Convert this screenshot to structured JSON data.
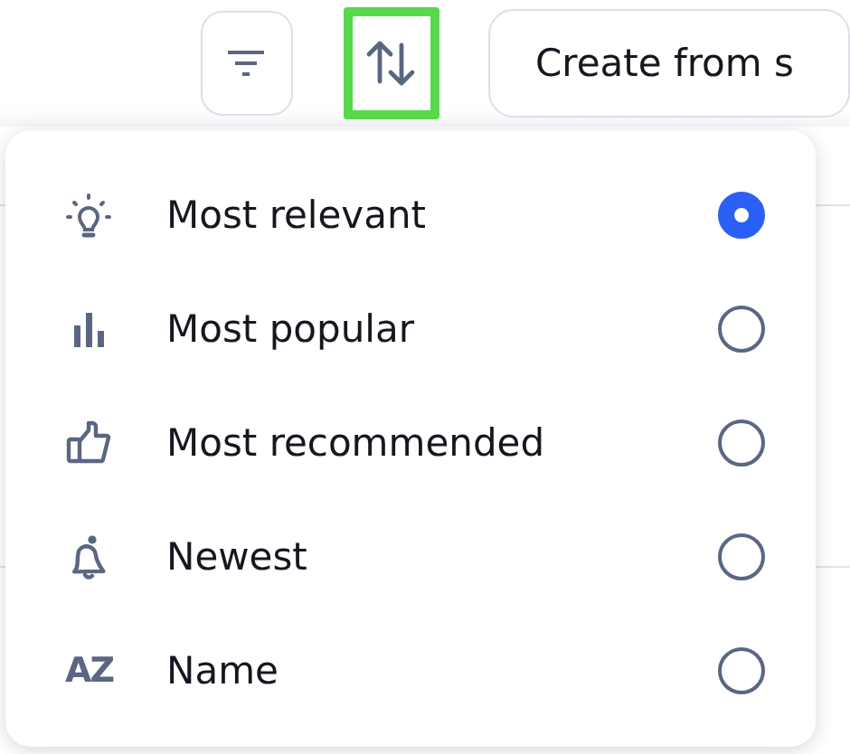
{
  "toolbar": {
    "filter_button": {
      "selected": false
    },
    "sort_button": {
      "selected": true
    },
    "create_button": {
      "label": "Create from s"
    }
  },
  "sort_menu": {
    "options": [
      {
        "kind": "bulb",
        "label": "Most relevant",
        "selected": true
      },
      {
        "kind": "bars",
        "label": "Most popular",
        "selected": false
      },
      {
        "kind": "thumb",
        "label": "Most recommended",
        "selected": false
      },
      {
        "kind": "bell",
        "label": "Newest",
        "selected": false
      },
      {
        "kind": "az",
        "icon_text": "AZ",
        "label": "Name",
        "selected": false
      }
    ]
  }
}
